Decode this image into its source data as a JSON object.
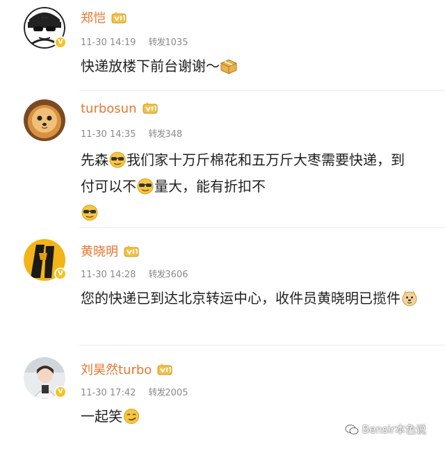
{
  "comments": [
    {
      "username": "郑恺",
      "time": "11-30 14:19",
      "likes_label": "转发",
      "likes": "1035",
      "text": "快递放楼下前台谢谢～",
      "emoji_end": "box-emoji"
    },
    {
      "username": "turbosun",
      "time": "11-30 14:35",
      "likes_label": "转发",
      "likes": "348",
      "text_parts": [
        "先森",
        "我们家十万斤棉花和五万斤大枣需要快递，到付可以不",
        "量大，能有折扣不"
      ],
      "emoji": "sunglasses-emoji"
    },
    {
      "username": "黄晓明",
      "time": "11-30 14:28",
      "likes_label": "转发",
      "likes": "3606",
      "text": "您的快递已到达北京转运中心，收件员黄晓明已揽件",
      "emoji_end": "doge-emoji"
    },
    {
      "username": "刘昊然turbo",
      "time": "11-30 17:42",
      "likes_label": "转发",
      "likes": "2005",
      "text": "一起笑",
      "emoji_end": "smirk-emoji"
    }
  ],
  "watermark": "Bensir本色说",
  "colors": {
    "username": "#e8762d",
    "meta": "#8a8a8a",
    "verified_badge": "#f6c222",
    "text": "#1f1f1f"
  }
}
